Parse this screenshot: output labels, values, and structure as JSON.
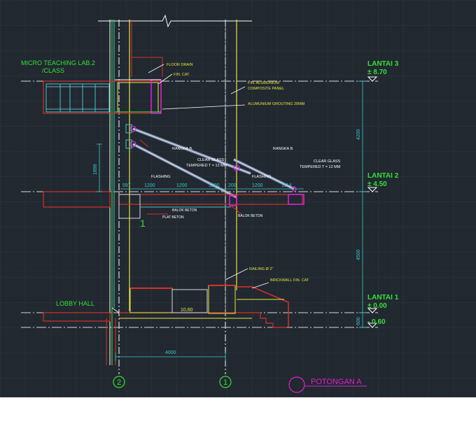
{
  "drawing": {
    "title": "POTONGAN  A",
    "rooms": {
      "upper_line1": "MICRO TEACHING LAB.2",
      "upper_line2": "/CLASS",
      "lower": "LOBBY HALL"
    },
    "levels": [
      {
        "name": "LANTAI 3",
        "elev": "± 8.70"
      },
      {
        "name": "LANTAI 2",
        "elev": "± 4.50"
      },
      {
        "name": "LANTAI 1",
        "elev": "± 0.00"
      },
      {
        "name": "",
        "elev": "- 0.60"
      }
    ],
    "grid_markers": [
      "2",
      "1"
    ],
    "detail_marker": "1",
    "dimensions": {
      "floor_3_2": "4200",
      "floor_2_1": "4500",
      "floor_1_0": "600",
      "height_left": "1896",
      "span_bottom": "4000",
      "stair_step": "10,60",
      "d1": "597",
      "d2": "1200",
      "d3": "1200",
      "d4": "1200",
      "d5": "200",
      "d6": "1200",
      "d7": "1114"
    },
    "notes": {
      "floor_drain": "FLOOR DRAIN",
      "fin_cat_1": "FIN. CAT",
      "acp_line1": "FIN. ALUMUNIUM",
      "acp_line2": "COMPOSITE PANEL",
      "grouting": "ALUMUNIUM GROUTING 20MM",
      "rangka_1": "RANGKA B.",
      "rangka_2": "RANGKA B.",
      "glass_1_line1": "CLEAR GLASS",
      "glass_1_line2": "TEMPERED T = 12 MM",
      "glass_2_line1": "CLEAR GLASS",
      "glass_2_line2": "TEMPERED T = 12 MM",
      "flashing_1": "FLASHING",
      "flashing_2": "FLASHING",
      "beam_1": "BALOK BETON",
      "beam_2": "PLAT BETON",
      "beam_3": "BALOK BETON",
      "railing": "RAILING Ø 2\"",
      "brickwall_fin": "BRICKWALL FIN. CAT"
    }
  },
  "colors": {
    "background": "#212830",
    "grid": "#2d3640",
    "level_text": "#35e035",
    "room_text": "#35e035",
    "dimension": "#3cc8c8",
    "title": "#e020c8",
    "structure_red": "#d8302a",
    "wall_yellow": "#e6e640",
    "canopy_glass": "#7f8fb0",
    "magenta": "#e020e0"
  }
}
